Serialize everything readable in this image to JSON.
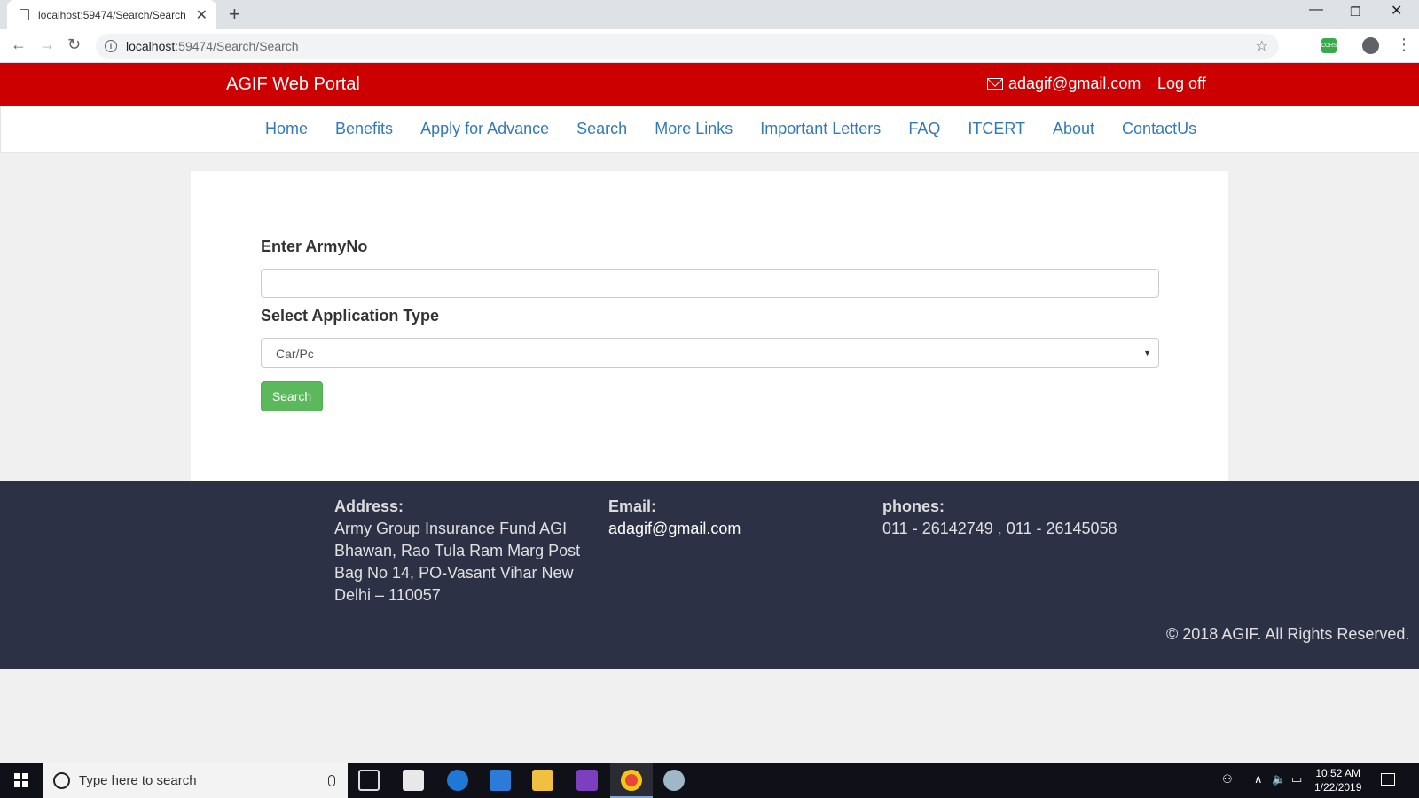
{
  "browser": {
    "tab_title": "localhost:59474/Search/Search",
    "url_host": "localhost",
    "url_path": ":59474/Search/Search"
  },
  "header": {
    "brand": "AGIF Web Portal",
    "email": "adagif@gmail.com",
    "logoff": "Log off"
  },
  "nav": {
    "items": [
      "Home",
      "Benefits",
      "Apply for Advance",
      "Search",
      "More Links",
      "Important Letters",
      "FAQ",
      "ITCERT",
      "About",
      "ContactUs"
    ]
  },
  "form": {
    "army_label": "Enter ArmyNo",
    "army_value": "",
    "type_label": "Select Application Type",
    "type_selected": "Car/Pc",
    "search_button": "Search"
  },
  "footer": {
    "address_heading": "Address:",
    "address_lines": [
      "Army Group Insurance Fund AGI",
      "Bhawan, Rao Tula Ram Marg Post",
      "Bag No 14, PO-Vasant Vihar New",
      "Delhi – 110057"
    ],
    "email_heading": "Email:",
    "email": "adagif@gmail.com",
    "phones_heading": "phones:",
    "phones": "011 - 26142749 , 011 - 26145058",
    "copyright": "©  2018 AGIF. All Rights Reserved."
  },
  "taskbar": {
    "search_placeholder": "Type here to search",
    "time": "10:52 AM",
    "date": "1/22/2019"
  }
}
